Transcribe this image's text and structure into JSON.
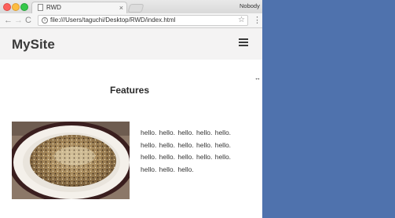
{
  "browser": {
    "tab_title": "RWD",
    "tab_close": "×",
    "profile_name": "Nobody",
    "back_icon": "←",
    "forward_icon": "→",
    "reload_icon": "C",
    "url": "file:///Users/taguchi/Desktop/RWD/index.html",
    "star_icon": "☆",
    "menu_icon": "⋮"
  },
  "site": {
    "logo": "MySite",
    "section_title": "Features",
    "body_text": "hello. hello. hello. hello. hello. hello. hello. hello. hello. hello. hello. hello. hello. hello. hello. hello. hello. hello.",
    "image_alt": "risotto-photo"
  },
  "devtools": {
    "resize_icon": "↔"
  },
  "colors": {
    "desktop": "#4f72ad",
    "header_bg": "#f4f3f3"
  }
}
